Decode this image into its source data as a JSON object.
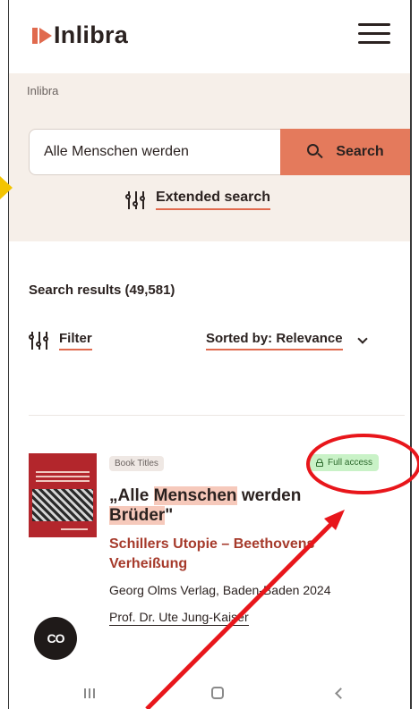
{
  "header": {
    "logo_text": "Inlibra",
    "menu_icon": "hamburger-menu-icon"
  },
  "breadcrumb": "Inlibra",
  "search": {
    "value": "Alle Menschen werden",
    "button_label": "Search",
    "button_icon": "search-icon",
    "extended_label": "Extended search",
    "extended_icon": "sliders-icon"
  },
  "results": {
    "count_label": "Search results (49,581)",
    "filter_label": "Filter",
    "sort_label": "Sorted by: Relevance"
  },
  "result_item": {
    "type_badge": "Book Titles",
    "access_badge": "Full access",
    "title_parts": [
      "„Alle ",
      "Menschen",
      " werden ",
      "Brüder",
      "\""
    ],
    "subtitle": "Schillers Utopie – Beethovens Verheißung",
    "publisher": "Georg Olms Verlag, Baden-Baden 2024",
    "author": "Prof. Dr. Ute Jung-Kaiser"
  },
  "chat_button": "CO",
  "colors": {
    "accent": "#e47a5c",
    "accent_dark": "#a63a2b",
    "search_bg": "#f6efe9",
    "badge_green": "#c9f2c7",
    "annotation_red": "#e8161b",
    "annotation_yellow": "#f3c400"
  }
}
